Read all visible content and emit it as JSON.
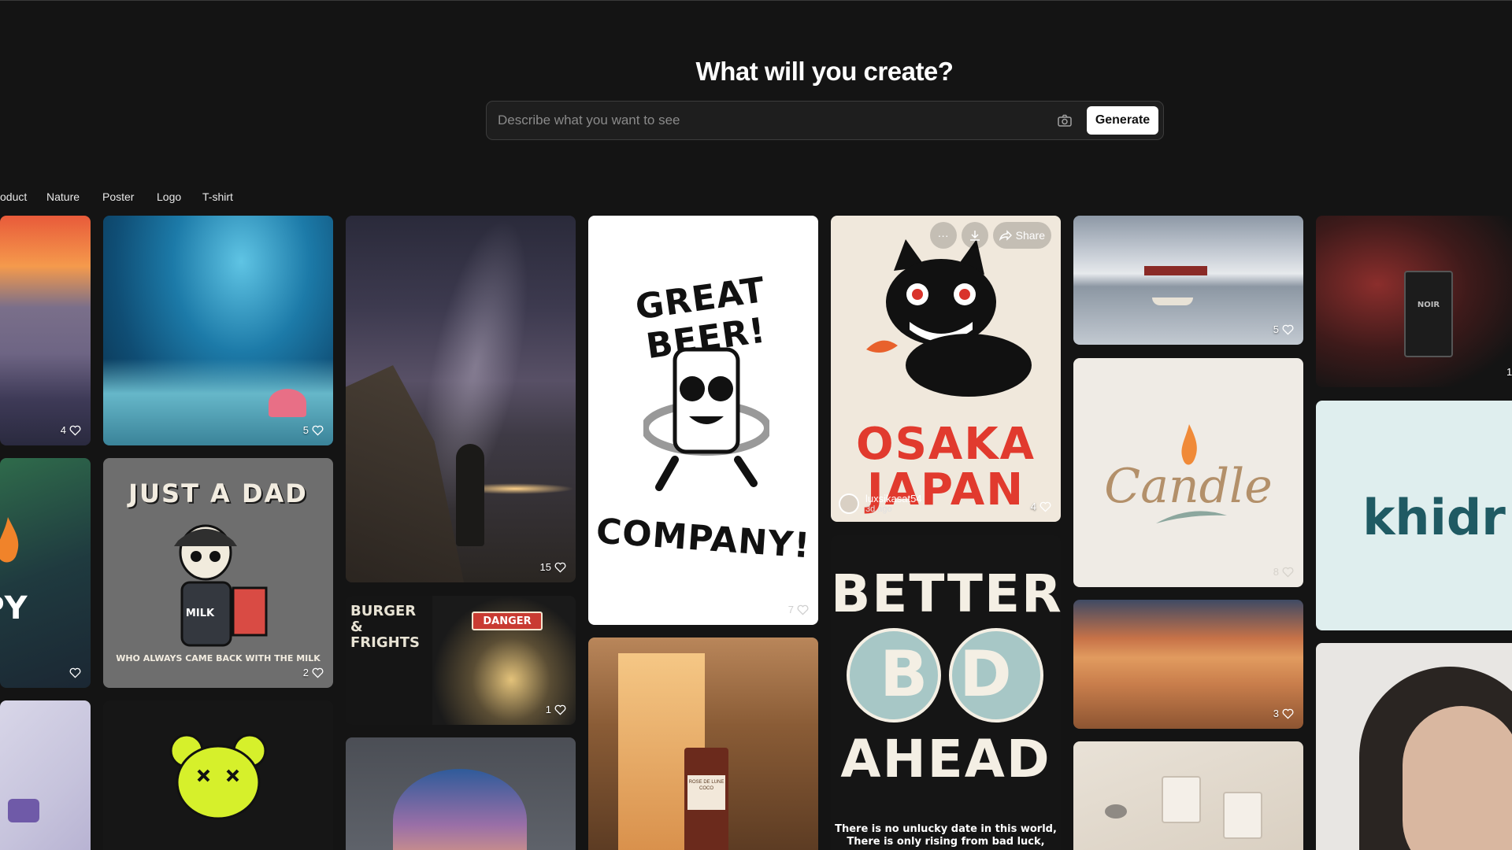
{
  "hero": {
    "title": "What will you create?",
    "prompt_placeholder": "Describe what you want to see",
    "generate_label": "Generate"
  },
  "categories": [
    "oduct",
    "Nature",
    "Poster",
    "Logo",
    "T-shirt"
  ],
  "tiles": {
    "beach": {
      "likes": "4"
    },
    "reef": {
      "likes": "5"
    },
    "green_logo": {
      "text": "PY"
    },
    "skeleton": {
      "likes": "2",
      "title": "JUST A DAD",
      "tagline": "WHO ALWAYS CAME BACK WITH THE MILK",
      "carton": "MILK"
    },
    "milkyway": {
      "likes": "15"
    },
    "burger": {
      "likes": "1",
      "title": "BURGER & FRIGHTS",
      "sign": "DANGER"
    },
    "beer": {
      "likes": "7",
      "line1": "GREAT BEER!",
      "line2": "COMPANY!"
    },
    "osaka": {
      "likes": "4",
      "line1": "OSAKA",
      "line2": "JAPAN",
      "author": "luxsikasat54",
      "time": "3d ago",
      "share_label": "Share"
    },
    "better": {
      "line1": "BETTER",
      "line2": "BD",
      "line3": "AHEAD",
      "caption1": "There is no unlucky date in this world,",
      "caption2": "There is only rising from bad luck,"
    },
    "lake": {
      "likes": "5"
    },
    "candle": {
      "likes": "8",
      "text": "Candle"
    },
    "desert": {
      "likes": "3"
    },
    "perfume": {
      "likes": "1",
      "label": "NOIR"
    },
    "khidr": {
      "text": "khidr"
    },
    "bottle": {
      "label": "ROSE DE LUNE COCO"
    }
  },
  "colors": {
    "accent": "#ffffff",
    "background": "#141414"
  }
}
